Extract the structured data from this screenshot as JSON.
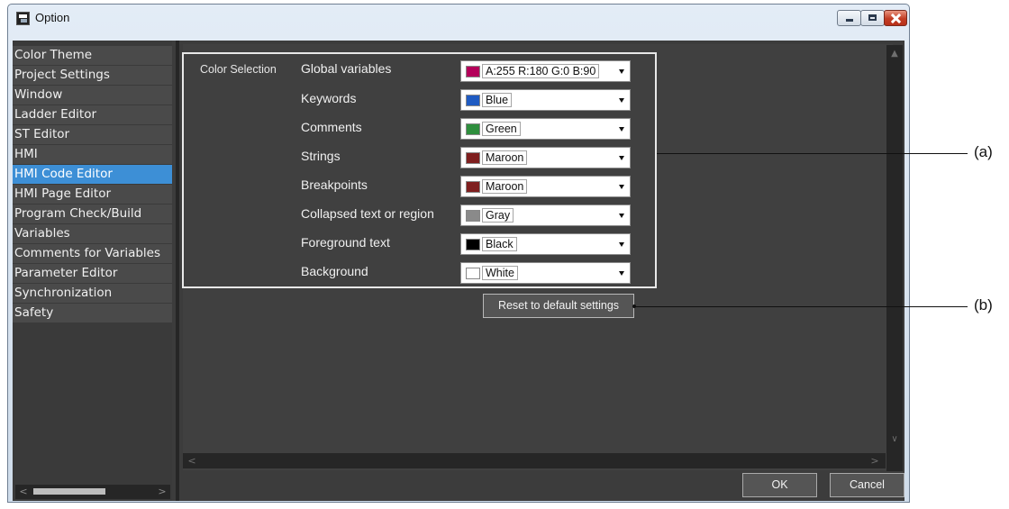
{
  "window": {
    "title": "Option"
  },
  "sidebar": {
    "items": [
      {
        "label": "Color Theme"
      },
      {
        "label": "Project Settings"
      },
      {
        "label": "Window"
      },
      {
        "label": "Ladder Editor"
      },
      {
        "label": "ST Editor"
      },
      {
        "label": "HMI"
      },
      {
        "label": "HMI Code Editor",
        "selected": true
      },
      {
        "label": "HMI Page Editor"
      },
      {
        "label": "Program Check/Build"
      },
      {
        "label": "Variables"
      },
      {
        "label": "Comments for Variables"
      },
      {
        "label": "Parameter Editor"
      },
      {
        "label": "Synchronization"
      },
      {
        "label": "Safety"
      }
    ]
  },
  "color_selection": {
    "group_label": "Color Selection",
    "rows": [
      {
        "label": "Global variables",
        "value": "A:255 R:180 G:0 B:90",
        "swatch": "#b4005a"
      },
      {
        "label": "Keywords",
        "value": "Blue",
        "swatch": "#1f5bc2"
      },
      {
        "label": "Comments",
        "value": "Green",
        "swatch": "#2f8f3e"
      },
      {
        "label": "Strings",
        "value": "Maroon",
        "swatch": "#7f1f1f"
      },
      {
        "label": "Breakpoints",
        "value": "Maroon",
        "swatch": "#7f1f1f"
      },
      {
        "label": "Collapsed text or region",
        "value": "Gray",
        "swatch": "#8a8a8a"
      },
      {
        "label": "Foreground text",
        "value": "Black",
        "swatch": "#000000"
      },
      {
        "label": "Background",
        "value": "White",
        "swatch": "#ffffff"
      }
    ],
    "reset_label": "Reset to default settings"
  },
  "buttons": {
    "ok": "OK",
    "cancel": "Cancel"
  },
  "callouts": {
    "a": "(a)",
    "b": "(b)"
  }
}
